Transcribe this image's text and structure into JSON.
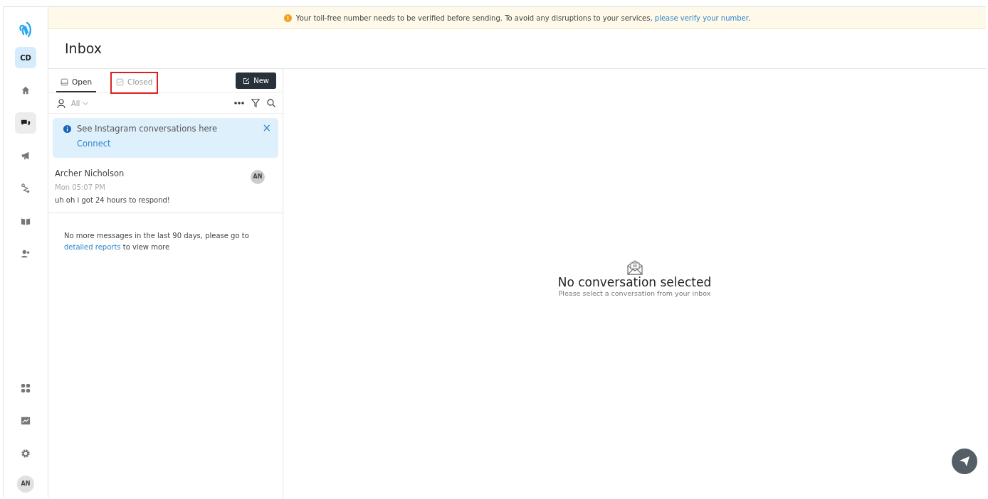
{
  "sidebar": {
    "workspace": "CD",
    "items": [
      {
        "selected": false
      },
      {
        "selected": true
      },
      {
        "selected": false
      },
      {
        "selected": false
      },
      {
        "selected": false
      },
      {
        "selected": false
      }
    ],
    "bottom_items": [
      {
        "selected": false
      },
      {
        "selected": false
      },
      {
        "selected": false
      }
    ],
    "user": "AN"
  },
  "banner": {
    "text": "Your toll-free number needs to be verified before sending. To avoid any disruptions to your services,",
    "link": "please verify your number",
    "end": "."
  },
  "page_title": "Inbox",
  "tabs": [
    {
      "label": "Open",
      "selected": true,
      "highlighted": false
    },
    {
      "label": "Closed",
      "selected": false,
      "highlighted": true
    }
  ],
  "new_button": "New",
  "filter": {
    "label": "All"
  },
  "notice": {
    "text": "See Instagram conversations here",
    "action": "Connect",
    "close": "×"
  },
  "conversations": [
    {
      "name": "Archer Nicholson",
      "time": "Mon 05:07 PM",
      "preview": "uh oh i got 24 hours to respond!",
      "avatar": "AN",
      "selected": false
    }
  ],
  "end_note": {
    "text": "No more messages in the last 90 days, please go to",
    "link": "detailed reports",
    "end": "to view more"
  },
  "empty_state": {
    "title": "No conversation selected",
    "subtitle": "Please select a conversation from your inbox"
  }
}
